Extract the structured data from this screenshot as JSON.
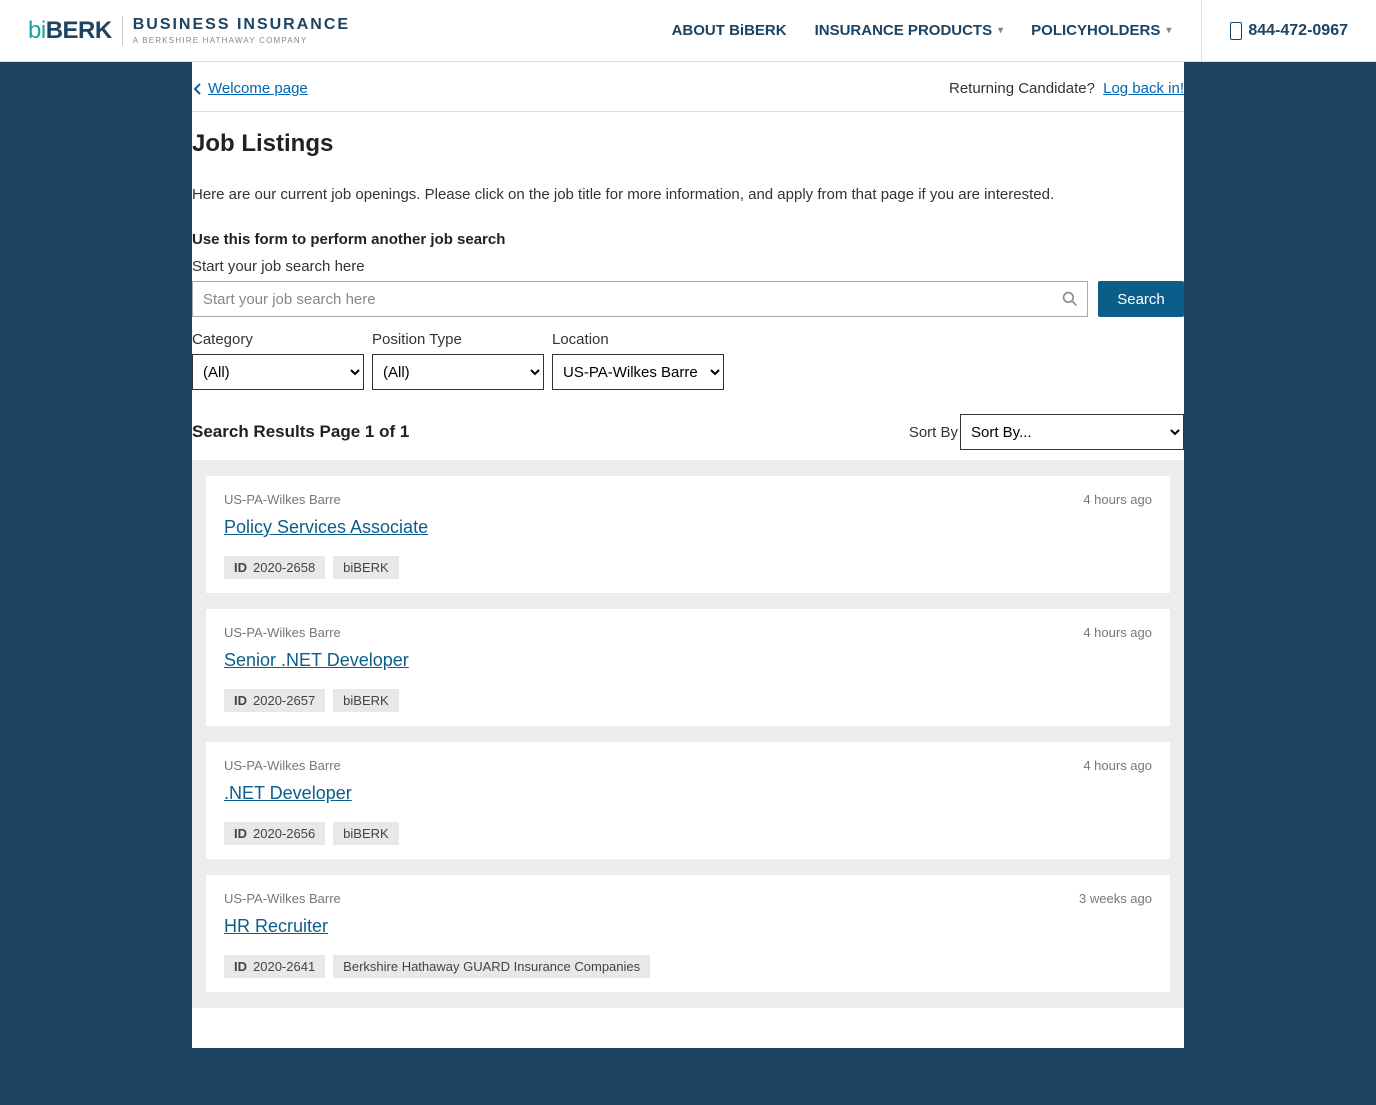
{
  "header": {
    "logo_bi": "bi",
    "logo_berk": "BERK",
    "logo_sub_top": "BUSINESS INSURANCE",
    "logo_sub_bot": "A BERKSHIRE HATHAWAY COMPANY",
    "nav": [
      {
        "label": "ABOUT BiBERK",
        "caret": false
      },
      {
        "label": "INSURANCE PRODUCTS",
        "caret": true
      },
      {
        "label": "POLICYHOLDERS",
        "caret": true
      }
    ],
    "phone": "844-472-0967"
  },
  "links": {
    "welcome": "Welcome page",
    "returning_text": "Returning Candidate?",
    "login": "Log back in!"
  },
  "main": {
    "title": "Job Listings",
    "intro": "Here are our current job openings. Please click on the job title for more information, and apply from that page if you are interested.",
    "form_heading": "Use this form to perform another job search",
    "search_label": "Start your job search here",
    "search_placeholder": "Start your job search here",
    "search_button": "Search",
    "filters": {
      "category": {
        "label": "Category",
        "selected": "(All)"
      },
      "position": {
        "label": "Position Type",
        "selected": "(All)"
      },
      "location": {
        "label": "Location",
        "selected": "US-PA-Wilkes Barre"
      }
    },
    "results_header": "Search Results Page 1 of 1",
    "sort_label": "Sort By",
    "sort_selected": "Sort By..."
  },
  "jobs": [
    {
      "location": "US-PA-Wilkes Barre",
      "posted": "4 hours ago",
      "title": "Policy Services Associate",
      "id": "2020-2658",
      "company": "biBERK"
    },
    {
      "location": "US-PA-Wilkes Barre",
      "posted": "4 hours ago",
      "title": "Senior .NET Developer",
      "id": "2020-2657",
      "company": "biBERK"
    },
    {
      "location": "US-PA-Wilkes Barre",
      "posted": "4 hours ago",
      "title": ".NET Developer",
      "id": "2020-2656",
      "company": "biBERK"
    },
    {
      "location": "US-PA-Wilkes Barre",
      "posted": "3 weeks ago",
      "title": "HR Recruiter",
      "id": "2020-2641",
      "company": "Berkshire Hathaway GUARD Insurance Companies"
    }
  ]
}
